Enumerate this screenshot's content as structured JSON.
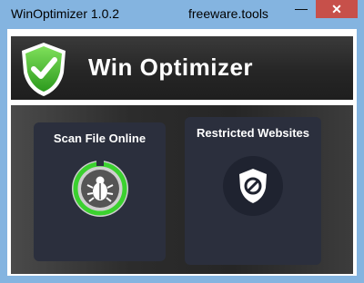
{
  "window": {
    "title": "WinOptimizer 1.0.2",
    "site": "freeware.tools",
    "minimize_glyph": "—",
    "close_glyph": "✕"
  },
  "header": {
    "app_title": "Win Optimizer",
    "logo_icon": "shield-check-icon"
  },
  "tiles": [
    {
      "label": "Scan File Online",
      "icon": "bug-scan-icon"
    },
    {
      "label": "Restricted Websites",
      "icon": "shield-block-icon"
    }
  ],
  "colors": {
    "accent_green": "#3bd12f",
    "close_button": "#c7504a",
    "tile_bg": "#2b2f3d"
  }
}
